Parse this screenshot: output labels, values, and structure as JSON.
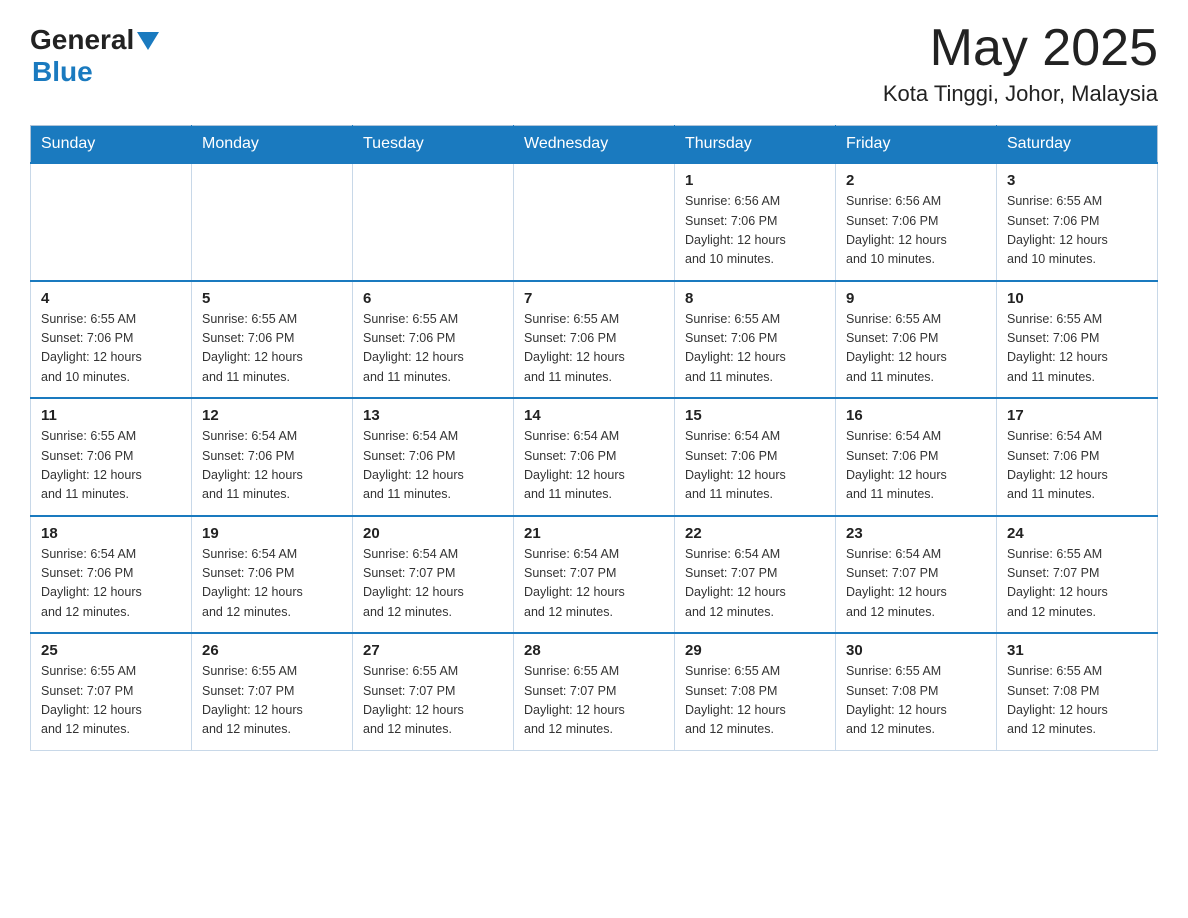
{
  "header": {
    "logo_general": "General",
    "logo_blue": "Blue",
    "title": "May 2025",
    "subtitle": "Kota Tinggi, Johor, Malaysia"
  },
  "calendar": {
    "days_of_week": [
      "Sunday",
      "Monday",
      "Tuesday",
      "Wednesday",
      "Thursday",
      "Friday",
      "Saturday"
    ],
    "weeks": [
      [
        {
          "day": "",
          "info": ""
        },
        {
          "day": "",
          "info": ""
        },
        {
          "day": "",
          "info": ""
        },
        {
          "day": "",
          "info": ""
        },
        {
          "day": "1",
          "info": "Sunrise: 6:56 AM\nSunset: 7:06 PM\nDaylight: 12 hours\nand 10 minutes."
        },
        {
          "day": "2",
          "info": "Sunrise: 6:56 AM\nSunset: 7:06 PM\nDaylight: 12 hours\nand 10 minutes."
        },
        {
          "day": "3",
          "info": "Sunrise: 6:55 AM\nSunset: 7:06 PM\nDaylight: 12 hours\nand 10 minutes."
        }
      ],
      [
        {
          "day": "4",
          "info": "Sunrise: 6:55 AM\nSunset: 7:06 PM\nDaylight: 12 hours\nand 10 minutes."
        },
        {
          "day": "5",
          "info": "Sunrise: 6:55 AM\nSunset: 7:06 PM\nDaylight: 12 hours\nand 11 minutes."
        },
        {
          "day": "6",
          "info": "Sunrise: 6:55 AM\nSunset: 7:06 PM\nDaylight: 12 hours\nand 11 minutes."
        },
        {
          "day": "7",
          "info": "Sunrise: 6:55 AM\nSunset: 7:06 PM\nDaylight: 12 hours\nand 11 minutes."
        },
        {
          "day": "8",
          "info": "Sunrise: 6:55 AM\nSunset: 7:06 PM\nDaylight: 12 hours\nand 11 minutes."
        },
        {
          "day": "9",
          "info": "Sunrise: 6:55 AM\nSunset: 7:06 PM\nDaylight: 12 hours\nand 11 minutes."
        },
        {
          "day": "10",
          "info": "Sunrise: 6:55 AM\nSunset: 7:06 PM\nDaylight: 12 hours\nand 11 minutes."
        }
      ],
      [
        {
          "day": "11",
          "info": "Sunrise: 6:55 AM\nSunset: 7:06 PM\nDaylight: 12 hours\nand 11 minutes."
        },
        {
          "day": "12",
          "info": "Sunrise: 6:54 AM\nSunset: 7:06 PM\nDaylight: 12 hours\nand 11 minutes."
        },
        {
          "day": "13",
          "info": "Sunrise: 6:54 AM\nSunset: 7:06 PM\nDaylight: 12 hours\nand 11 minutes."
        },
        {
          "day": "14",
          "info": "Sunrise: 6:54 AM\nSunset: 7:06 PM\nDaylight: 12 hours\nand 11 minutes."
        },
        {
          "day": "15",
          "info": "Sunrise: 6:54 AM\nSunset: 7:06 PM\nDaylight: 12 hours\nand 11 minutes."
        },
        {
          "day": "16",
          "info": "Sunrise: 6:54 AM\nSunset: 7:06 PM\nDaylight: 12 hours\nand 11 minutes."
        },
        {
          "day": "17",
          "info": "Sunrise: 6:54 AM\nSunset: 7:06 PM\nDaylight: 12 hours\nand 11 minutes."
        }
      ],
      [
        {
          "day": "18",
          "info": "Sunrise: 6:54 AM\nSunset: 7:06 PM\nDaylight: 12 hours\nand 12 minutes."
        },
        {
          "day": "19",
          "info": "Sunrise: 6:54 AM\nSunset: 7:06 PM\nDaylight: 12 hours\nand 12 minutes."
        },
        {
          "day": "20",
          "info": "Sunrise: 6:54 AM\nSunset: 7:07 PM\nDaylight: 12 hours\nand 12 minutes."
        },
        {
          "day": "21",
          "info": "Sunrise: 6:54 AM\nSunset: 7:07 PM\nDaylight: 12 hours\nand 12 minutes."
        },
        {
          "day": "22",
          "info": "Sunrise: 6:54 AM\nSunset: 7:07 PM\nDaylight: 12 hours\nand 12 minutes."
        },
        {
          "day": "23",
          "info": "Sunrise: 6:54 AM\nSunset: 7:07 PM\nDaylight: 12 hours\nand 12 minutes."
        },
        {
          "day": "24",
          "info": "Sunrise: 6:55 AM\nSunset: 7:07 PM\nDaylight: 12 hours\nand 12 minutes."
        }
      ],
      [
        {
          "day": "25",
          "info": "Sunrise: 6:55 AM\nSunset: 7:07 PM\nDaylight: 12 hours\nand 12 minutes."
        },
        {
          "day": "26",
          "info": "Sunrise: 6:55 AM\nSunset: 7:07 PM\nDaylight: 12 hours\nand 12 minutes."
        },
        {
          "day": "27",
          "info": "Sunrise: 6:55 AM\nSunset: 7:07 PM\nDaylight: 12 hours\nand 12 minutes."
        },
        {
          "day": "28",
          "info": "Sunrise: 6:55 AM\nSunset: 7:07 PM\nDaylight: 12 hours\nand 12 minutes."
        },
        {
          "day": "29",
          "info": "Sunrise: 6:55 AM\nSunset: 7:08 PM\nDaylight: 12 hours\nand 12 minutes."
        },
        {
          "day": "30",
          "info": "Sunrise: 6:55 AM\nSunset: 7:08 PM\nDaylight: 12 hours\nand 12 minutes."
        },
        {
          "day": "31",
          "info": "Sunrise: 6:55 AM\nSunset: 7:08 PM\nDaylight: 12 hours\nand 12 minutes."
        }
      ]
    ]
  }
}
